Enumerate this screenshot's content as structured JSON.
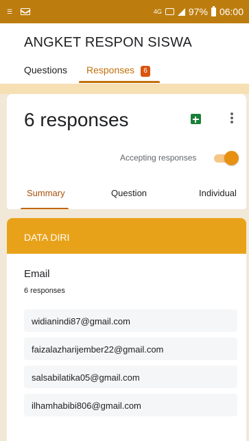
{
  "status_bar": {
    "network_type": "4G",
    "battery": "97%",
    "time": "06:00"
  },
  "header": {
    "form_title": "ANGKET RESPON SISWA",
    "tabs": [
      {
        "label": "Questions"
      },
      {
        "label": "Responses",
        "badge": "6"
      }
    ]
  },
  "summary": {
    "count_text": "6 responses",
    "accepting_label": "Accepting responses",
    "accepting": true,
    "tabs": [
      {
        "label": "Summary"
      },
      {
        "label": "Question"
      },
      {
        "label": "Individual"
      }
    ]
  },
  "section": {
    "title": "DATA DIRI",
    "question": "Email",
    "response_count": "6 responses",
    "emails": [
      "widianindi87@gmail.com",
      "faizalazharijember22@gmail.com",
      "salsabilatika05@gmail.com",
      "ilhamhabibi806@gmail.com"
    ]
  },
  "colors": {
    "accent": "#e8a21a",
    "status_bar": "#bd7d0e",
    "badge": "#d9540f",
    "sheets_green": "#188038"
  }
}
